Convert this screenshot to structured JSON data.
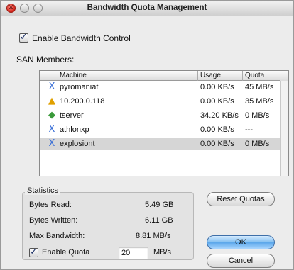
{
  "window": {
    "title": "Bandwidth Quota Management"
  },
  "enable_control": {
    "label": "Enable Bandwidth Control",
    "checked": true,
    "check_glyph": "✓"
  },
  "members": {
    "label": "SAN Members:",
    "columns": [
      "Machine",
      "Usage",
      "Quota"
    ],
    "rows": [
      {
        "icon": "x-icon",
        "glyph": "X",
        "machine": "pyromaniat",
        "usage": "0.00 KB/s",
        "quota": "45 MB/s",
        "selected": false
      },
      {
        "icon": "warning-icon",
        "glyph": "▲",
        "machine": "10.200.0.118",
        "usage": "0.00 KB/s",
        "quota": "35 MB/s",
        "selected": false
      },
      {
        "icon": "server-app-icon",
        "glyph": "◆",
        "machine": "tserver",
        "usage": "34.20 KB/s",
        "quota": "0 MB/s",
        "selected": false
      },
      {
        "icon": "x-icon",
        "glyph": "X",
        "machine": "athlonxp",
        "usage": "0.00 KB/s",
        "quota": "---",
        "selected": false
      },
      {
        "icon": "x-icon",
        "glyph": "X",
        "machine": "explosiont",
        "usage": "0.00 KB/s",
        "quota": "0 MB/s",
        "selected": true
      }
    ]
  },
  "statistics": {
    "title": "Statistics",
    "bytes_read_label": "Bytes Read:",
    "bytes_read_value": "5.49 GB",
    "bytes_written_label": "Bytes Written:",
    "bytes_written_value": "6.11 GB",
    "max_bw_label": "Max Bandwidth:",
    "max_bw_value": "8.81 MB/s",
    "enable_quota_label": "Enable Quota",
    "enable_quota_checked": true,
    "check_glyph": "✓",
    "quota_value": "20",
    "quota_unit": "MB/s"
  },
  "buttons": {
    "reset": "Reset Quotas",
    "ok": "OK",
    "cancel": "Cancel"
  },
  "colors": {
    "default_button": "#5aa6ea",
    "selection": "#d6d6d6"
  }
}
